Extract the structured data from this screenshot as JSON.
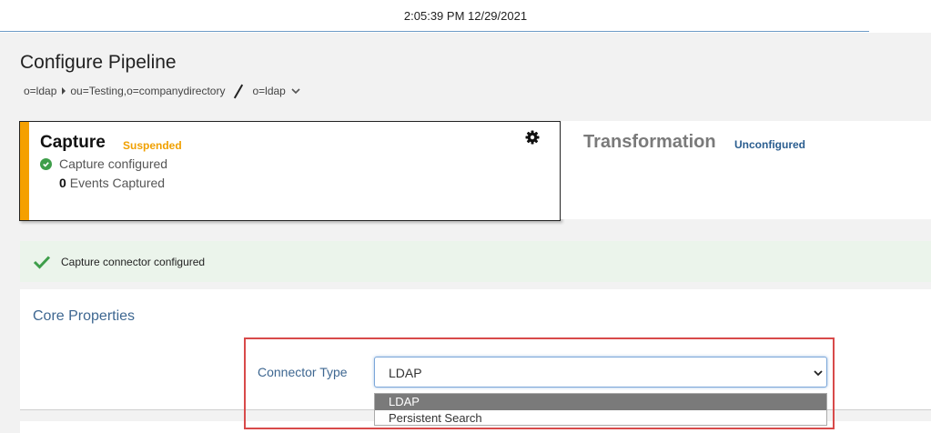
{
  "topbar": {
    "clock": "2:05:39 PM 12/29/2021"
  },
  "page": {
    "title": "Configure Pipeline"
  },
  "breadcrumb": {
    "root": "o=ldap",
    "child": "ou=Testing,o=companydirectory",
    "current": "o=ldap"
  },
  "capture": {
    "title": "Capture",
    "status": "Suspended",
    "status_color": "#f0a000",
    "configured_text": "Capture configured",
    "events_count": "0",
    "events_label": "Events Captured"
  },
  "transformation": {
    "title": "Transformation",
    "status": "Unconfigured"
  },
  "notice": {
    "text": "Capture connector configured"
  },
  "core_properties": {
    "heading": "Core Properties",
    "connector_type_label": "Connector Type",
    "connector_type_value": "LDAP",
    "options": [
      "LDAP",
      "Persistent Search"
    ]
  },
  "icons": {
    "breadcrumb_separator": "caret-right-icon",
    "breadcrumb_dropdown": "chevron-down-icon",
    "settings": "gear-icon",
    "configured": "check-circle-icon",
    "notice": "check-icon",
    "select": "chevron-down-icon"
  },
  "colors": {
    "accent": "#f5a000",
    "link_blue": "#3e6791",
    "success_green": "#3e9e4a",
    "highlight_red": "#d84a4a"
  }
}
